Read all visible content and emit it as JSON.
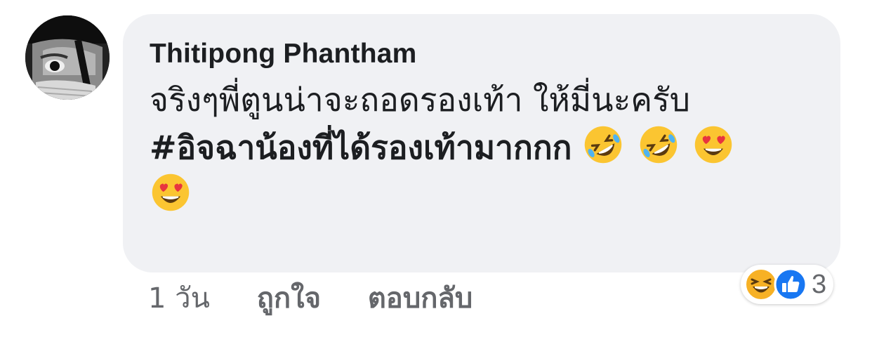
{
  "comment": {
    "author": "Thitipong Phantham",
    "text_line1": "จริงๆพี่ตูนน่าจะถอดรองเท้า ให้มี่นะครับ",
    "hashtag": "#อิจฉาน้องที่ได้รองเท้ามากกก",
    "emojis": [
      "rolling-on-floor-laughing",
      "rolling-on-floor-laughing",
      "heart-eyes",
      "heart-eyes"
    ]
  },
  "actions": {
    "time": "1 วัน",
    "like": "ถูกใจ",
    "reply": "ตอบกลับ"
  },
  "reactions": {
    "icons": [
      "laughing-face-icon",
      "like-thumb-icon"
    ],
    "count": "3",
    "like_color": "#1877f2",
    "haha_color": "#f7b125"
  }
}
